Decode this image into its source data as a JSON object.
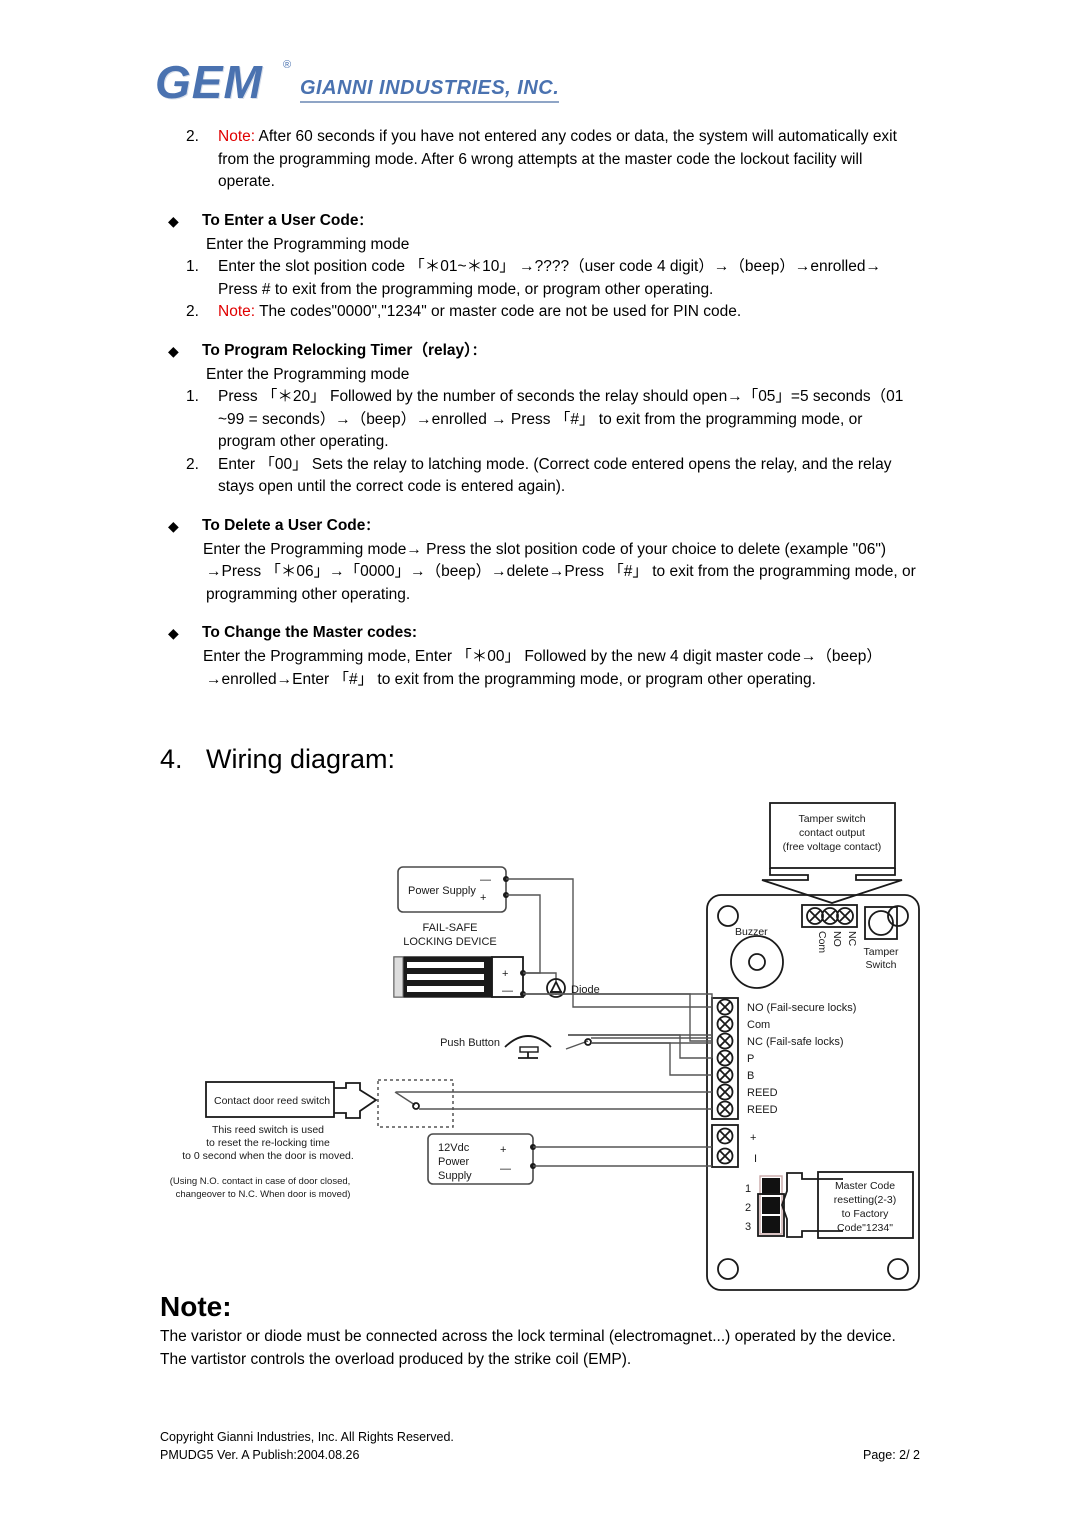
{
  "header": {
    "logo_main": "GEM",
    "logo_reg": "®",
    "logo_sub": "GIANNI INDUSTRIES, INC.",
    "logo_color": "#4a72b0"
  },
  "content": {
    "item2_label": "2.",
    "item2_note": "Note:",
    "item2_text": " After 60 seconds if you have not entered any codes or data, the system will automatically exit from the programming mode. After 6 wrong attempts at the master code the lockout facility will operate.",
    "sections": [
      {
        "title": "To Enter a User Code",
        "title_colon": "：",
        "lead": "Enter the Programming mode",
        "items": [
          {
            "num": "1.",
            "text": "Enter the slot position code 「＊01~＊10」 →????（user code 4 digit）→（beep）→enrolled→ Press # to exit from the programming mode, or program other operating."
          },
          {
            "num": "2.",
            "note": "Note:",
            "text": " The codes\"0000\",\"1234\" or master code are not be used for PIN code."
          }
        ]
      },
      {
        "title": "To Program Relocking Timer（relay）",
        "title_colon": "：",
        "lead": "Enter the Programming mode",
        "items": [
          {
            "num": "1.",
            "text": "Press 「＊20」 Followed by the number of seconds the relay should open→「05」=5 seconds（01 ~99 = seconds）→（beep）→enrolled → Press 「#」 to exit from the programming mode, or program other operating."
          },
          {
            "num": "2.",
            "text": "Enter 「00」 Sets the relay to latching mode. (Correct code entered opens the relay, and the relay stays open until the correct code is entered again)."
          }
        ]
      },
      {
        "title": "To Delete a User Code",
        "title_colon": "：",
        "para": "Enter the Programming mode→ Press the slot position code of your choice to delete (example \"06\") →Press 「＊06」→「0000」→（beep）→delete→Press 「#」 to exit from the programming mode, or programming other operating."
      },
      {
        "title": "To Change the Master codes:",
        "title_colon": "",
        "para": "Enter the Programming mode, Enter 「＊00」 Followed by the new 4 digit master code→（beep）→enrolled→Enter 「#」 to exit from the programming mode, or program other operating."
      }
    ]
  },
  "section4": {
    "number": "4.",
    "title": "Wiring diagram:"
  },
  "diagram": {
    "tamper_callout": [
      "Tamper switch",
      "contact output",
      "(free voltage contact)"
    ],
    "buzzer_label": "Buzzer",
    "tamper_switch_label": [
      "Tamper",
      "Switch"
    ],
    "top_terminal_labels": [
      "Com",
      "NO",
      "NC"
    ],
    "power_supply_label": "Power Supply",
    "power_supply_minus": "—",
    "power_supply_plus": "+",
    "lock_label": [
      "FAIL-SAFE",
      "LOCKING DEVICE"
    ],
    "lock_plus": "+",
    "lock_minus": "—",
    "diode_label": "Diode",
    "diode_symbol": "⌂",
    "push_button_label": "Push Button",
    "reed_callout": "Contact door reed switch",
    "reed_note": [
      "This reed switch is used",
      "to reset the re-locking time",
      "to 0 second when the door is moved."
    ],
    "reed_note2": [
      "(Using N.O. contact in case of door closed,",
      "changeover to N.C. When door is moved)"
    ],
    "dc_supply_label": [
      "12Vdc",
      "Power",
      "Supply"
    ],
    "dc_plus": "+",
    "dc_minus": "—",
    "terminal_labels": [
      "NO  (Fail-secure locks)",
      "Com",
      "NC     (Fail-safe locks)",
      "P",
      "B",
      "REED",
      "REED"
    ],
    "power_terminal_labels": [
      "+",
      "I"
    ],
    "jumper_labels": [
      "1",
      "2",
      "3"
    ],
    "jumper_callout": [
      "Master Code",
      "resetting(2-3)",
      "to Factory",
      "Code\"1234\""
    ]
  },
  "note": {
    "heading": "Note:",
    "text": "The varistor or diode must be connected across the lock terminal (electromagnet...) operated by the device. The vartistor controls the overload produced by the strike coil (EMP)."
  },
  "footer": {
    "copyright": "Copyright Gianni Industries, Inc. All Rights Reserved.",
    "version": "PMUDG5  Ver. A  Publish:2004.08.26",
    "page": "Page: 2/ 2"
  }
}
